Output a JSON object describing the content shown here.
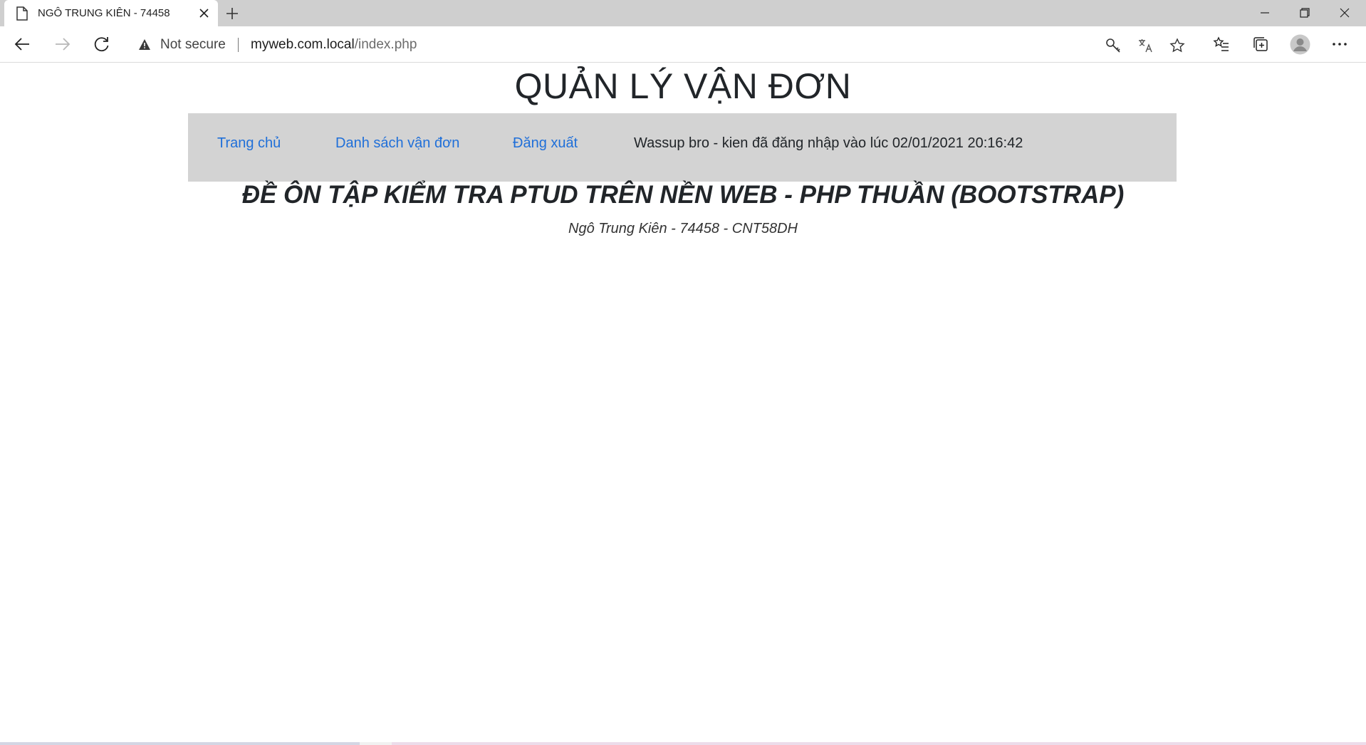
{
  "browser": {
    "tab": {
      "title": "NGÔ TRUNG KIÊN - 74458"
    },
    "address_bar": {
      "security_label": "Not secure",
      "url_host": "myweb.com.local",
      "url_path": "/index.php"
    },
    "icons": {
      "tab": "document-icon",
      "close": "close-icon",
      "new_tab": "plus-icon",
      "back": "back-arrow-icon",
      "forward": "forward-arrow-icon",
      "reload": "reload-icon",
      "security": "warning-icon",
      "key": "key-icon",
      "translate": "translate-icon",
      "favorite": "star-icon",
      "favorites": "favorites-icon",
      "collections": "collections-icon",
      "profile": "avatar",
      "more": "more-icon"
    }
  },
  "page": {
    "heading": "QUẢN LÝ VẬN ĐƠN",
    "nav": {
      "items": [
        {
          "label": "Trang chủ"
        },
        {
          "label": "Danh sách vận đơn"
        },
        {
          "label": "Đăng xuất"
        }
      ],
      "status": "Wassup bro - kien đã đăng nhập vào lúc 02/01/2021 20:16:42"
    },
    "subtitle": "ĐỀ ÔN TẬP KIỂM TRA PTUD TRÊN NỀN WEB - PHP THUẦN (BOOTSTRAP)",
    "author": "Ngô Trung Kiên - 74458 - CNT58DH"
  },
  "colors": {
    "link": "#1f6fd9",
    "navbar_bg": "#d3d3d3",
    "tabbar_bg": "#cfcfcf"
  }
}
